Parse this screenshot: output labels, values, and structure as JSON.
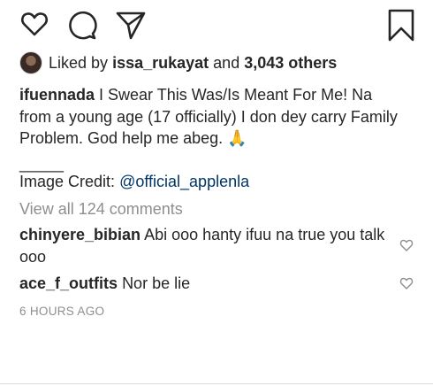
{
  "actions": {
    "like_icon": "heart-icon",
    "comment_icon": "comment-icon",
    "share_icon": "send-icon",
    "save_icon": "bookmark-icon"
  },
  "likes": {
    "prefix": "Liked by",
    "user": "issa_rukayat",
    "joiner": "and",
    "others": "3,043 others"
  },
  "caption": {
    "username": "ifuennada",
    "text": "I Swear This Was/Is Meant For Me! Na from a young age (17 officially) I don dey carry Family Problem. God help me abeg. 🙏"
  },
  "credit": {
    "separator": "_____",
    "label": "Image Credit:",
    "handle": "@official_applenla"
  },
  "view_all": "View all 124 comments",
  "comments": [
    {
      "username": "chinyere_bibian",
      "text": "Abi ooo hanty ifuu na true you talk ooo"
    },
    {
      "username": "ace_f_outfits",
      "text": "Nor be lie"
    }
  ],
  "timestamp": "6 HOURS AGO",
  "colors": {
    "text": "#262626",
    "muted": "#8e8e8e",
    "link": "#003569"
  }
}
